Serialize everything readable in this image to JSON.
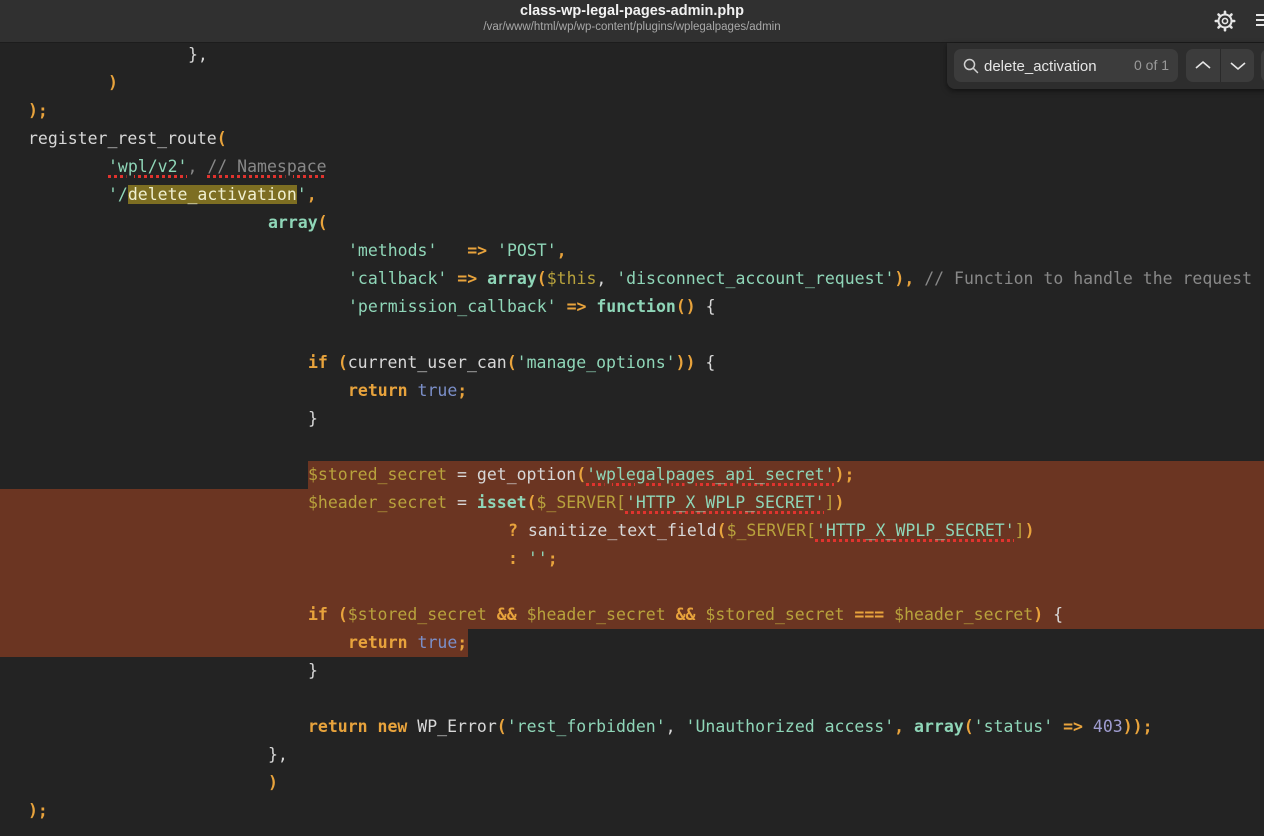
{
  "window": {
    "title": "class-wp-legal-pages-admin.php",
    "path": "/var/www/html/wp/wp-content/plugins/wplegalpages/admin"
  },
  "icons": {
    "settings": "gear-icon",
    "menu": "hamburger-menu-icon",
    "search": "search-icon",
    "previous": "chevron-up-icon",
    "next": "chevron-down-icon"
  },
  "search": {
    "query": "delete_activation",
    "match_count": "0 of 1"
  },
  "code": {
    "l1": "},",
    "l2": ")",
    "l3": ");",
    "l4": {
      "fn": "register_rest_route",
      "p": "("
    },
    "l5": {
      "s": "'wpl/v2'",
      "sep": ", ",
      "c": "// Namespace"
    },
    "l6": {
      "q1": "'/",
      "m": "delete_activation",
      "q2": "'",
      "comma": ","
    },
    "l7": {
      "kw": "array",
      "p": "("
    },
    "l8": {
      "s1": "'methods'",
      "sp": "  ",
      "arrow": "=>",
      "s2": "'POST'",
      "comma": ","
    },
    "l9": {
      "s1": "'callback'",
      "arrow": "=>",
      "kw": "array",
      "p1": "(",
      "v": "$this",
      "sep": ", ",
      "s2": "'disconnect_account_request'",
      "p2": ")",
      "comma": ",",
      "c": "// Function to handle the request"
    },
    "l10": {
      "s": "'permission_callback'",
      "arrow": "=>",
      "kw": "function",
      "p": "()",
      "brace": "{"
    },
    "l12": {
      "kw": "if",
      "p1": "(",
      "fn": "current_user_can",
      "p2": "(",
      "s": "'manage_options'",
      "p3": "))",
      "brace": "{"
    },
    "l13": {
      "kw": "return",
      "b": "true",
      "semi": ";"
    },
    "l14": "}",
    "l16": {
      "v": "$stored_secret",
      "eq": " = ",
      "fn": "get_option",
      "p1": "(",
      "s": "'wplegalpages_api_secret'",
      "p2": ")",
      "semi": ";"
    },
    "l17": {
      "v": "$header_secret",
      "eq": " = ",
      "kw": "isset",
      "p1": "(",
      "v2": "$_SERVER",
      "b1": "[",
      "s": "'HTTP_X_WPLP_SECRET'",
      "b2": "]",
      "p2": ")"
    },
    "l18": {
      "q": "?",
      "fn": "sanitize_text_field",
      "p1": "(",
      "v": "$_SERVER",
      "b1": "[",
      "s": "'HTTP_X_WPLP_SECRET'",
      "b2": "]",
      "p2": ")"
    },
    "l19": {
      "colon": ":",
      "s": "''",
      "semi": ";"
    },
    "l21": {
      "kw": "if",
      "p1": "(",
      "v1": "$stored_secret",
      "and1": "&&",
      "v2": "$header_secret",
      "and2": "&&",
      "v3": "$stored_secret",
      "eq3": "===",
      "v4": "$header_secret",
      "p2": ")",
      "brace": "{"
    },
    "l22": {
      "kw": "return",
      "b": "true",
      "semi": ";"
    },
    "l23": "}",
    "l25": {
      "kw1": "return",
      "kw2": "new",
      "cls": "WP_Error",
      "p1": "(",
      "s1": "'rest_forbidden'",
      "sep": ", ",
      "s2": "'Unauthorized access'",
      "kw3": "array",
      "p2": "(",
      "s3": "'status'",
      "arrow": "=>",
      "n": "403",
      "p3": "));"
    },
    "l26": "},",
    "l27": ")",
    "l28": ");"
  },
  "colors": {
    "background": "#232323",
    "header": "#303030",
    "selection_band": "#6b3522",
    "search_match": "#7d6e22",
    "punctuation": "#e8a33c",
    "string": "#8fd6b8",
    "comment": "#888888",
    "variable": "#b8a23c",
    "boolean": "#7b8fc9",
    "number": "#9f9cd0"
  }
}
